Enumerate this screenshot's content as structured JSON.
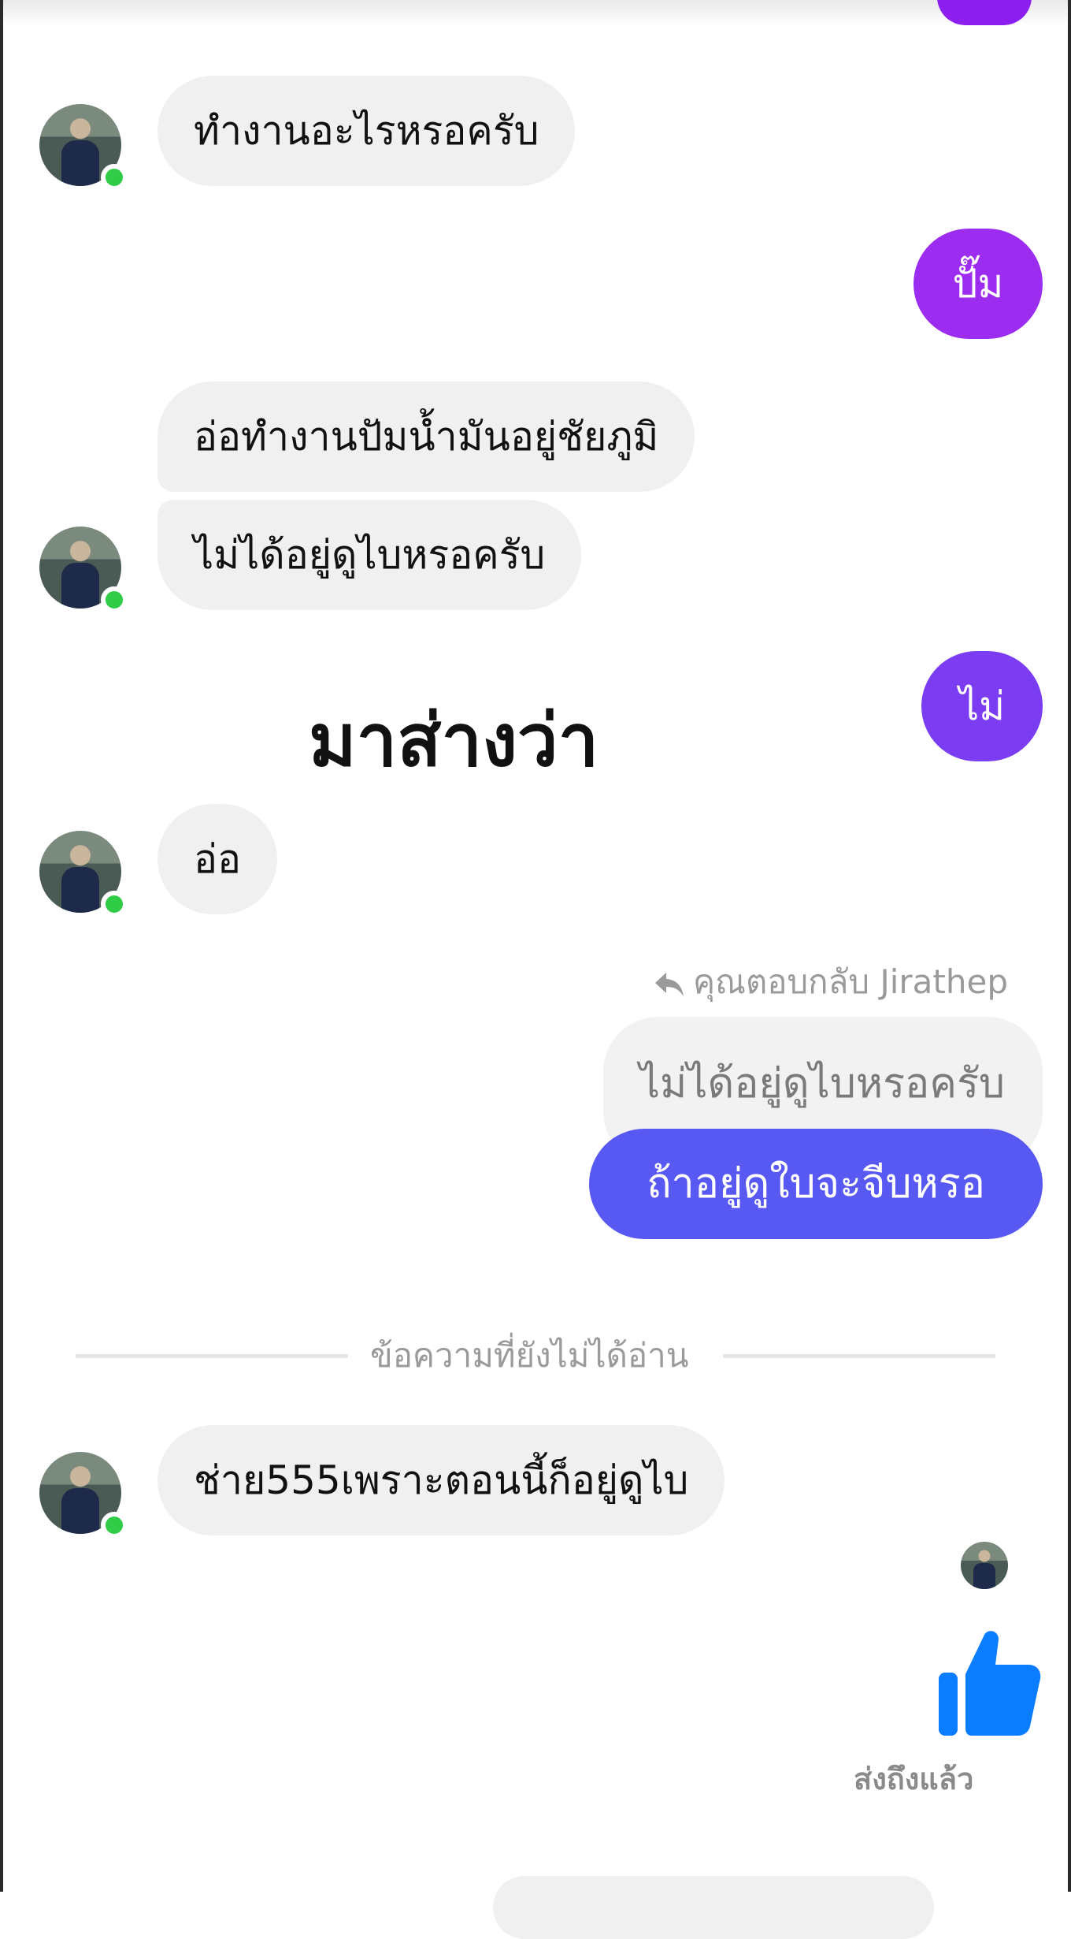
{
  "messages": [
    {
      "id": "m1",
      "side": "incoming",
      "text": "ทำงานอะไรหรอครับ"
    },
    {
      "id": "m2",
      "side": "outgoing",
      "text": "ปั๊ม"
    },
    {
      "id": "m3",
      "side": "incoming",
      "text": "อ่อทำงานปัมน้ำมันอยู่ชัยภูมิ"
    },
    {
      "id": "m4",
      "side": "incoming",
      "text": "ไม่ได้อยู่ดูไบหรอครับ"
    },
    {
      "id": "m5",
      "side": "outgoing",
      "text": "ไม่"
    },
    {
      "id": "m6",
      "side": "incoming",
      "text": "อ่อ"
    },
    {
      "id": "m7",
      "side": "outgoing",
      "text": "ถ้าอยู่ดูใบจะจีบหรอ"
    },
    {
      "id": "m8",
      "side": "incoming",
      "text": "ช่าย555เพราะตอนนี้ก็อยู่ดูไบ"
    }
  ],
  "overlay_caption": "มาส่างว่า",
  "reply": {
    "label": "คุณตอบกลับ Jirathep",
    "quoted_text": "ไม่ได้อยู่ดูไบหรอครับ",
    "icon": "reply-arrow-icon"
  },
  "unread_divider": "ข้อความที่ยังไม่ได้อ่าน",
  "like": {
    "icon": "thumbs-up-icon",
    "color": "#0a7cff"
  },
  "delivery_status": "ส่งถึงแล้ว",
  "colors": {
    "incoming_bubble": "#f0f0f0",
    "outgoing_purple": "#9b2cf0",
    "outgoing_violet": "#7b3cf2",
    "outgoing_blue": "#5858f2",
    "online_dot": "#31cc46"
  }
}
